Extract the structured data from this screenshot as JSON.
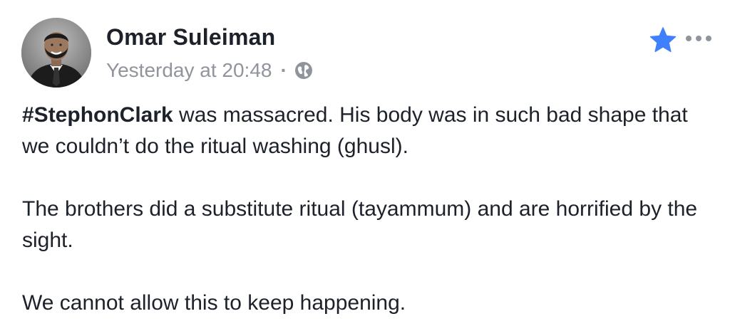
{
  "post": {
    "author": "Omar Suleiman",
    "timestamp": "Yesterday at 20:48",
    "separator": "·",
    "privacy_icon": "globe-icon",
    "favorite_icon": "star-icon",
    "more_icon": "more-options-icon",
    "accent_color": "#4080ff",
    "paragraph1": {
      "hashtag": "#StephonClark",
      "text": " was massacred. His body was in such bad shape that we couldn’t do the ritual washing (ghusl)."
    },
    "paragraph2": "The brothers did a substitute ritual (tayammum) and are horrified by the sight.",
    "paragraph3": "We cannot allow this to keep happening."
  }
}
